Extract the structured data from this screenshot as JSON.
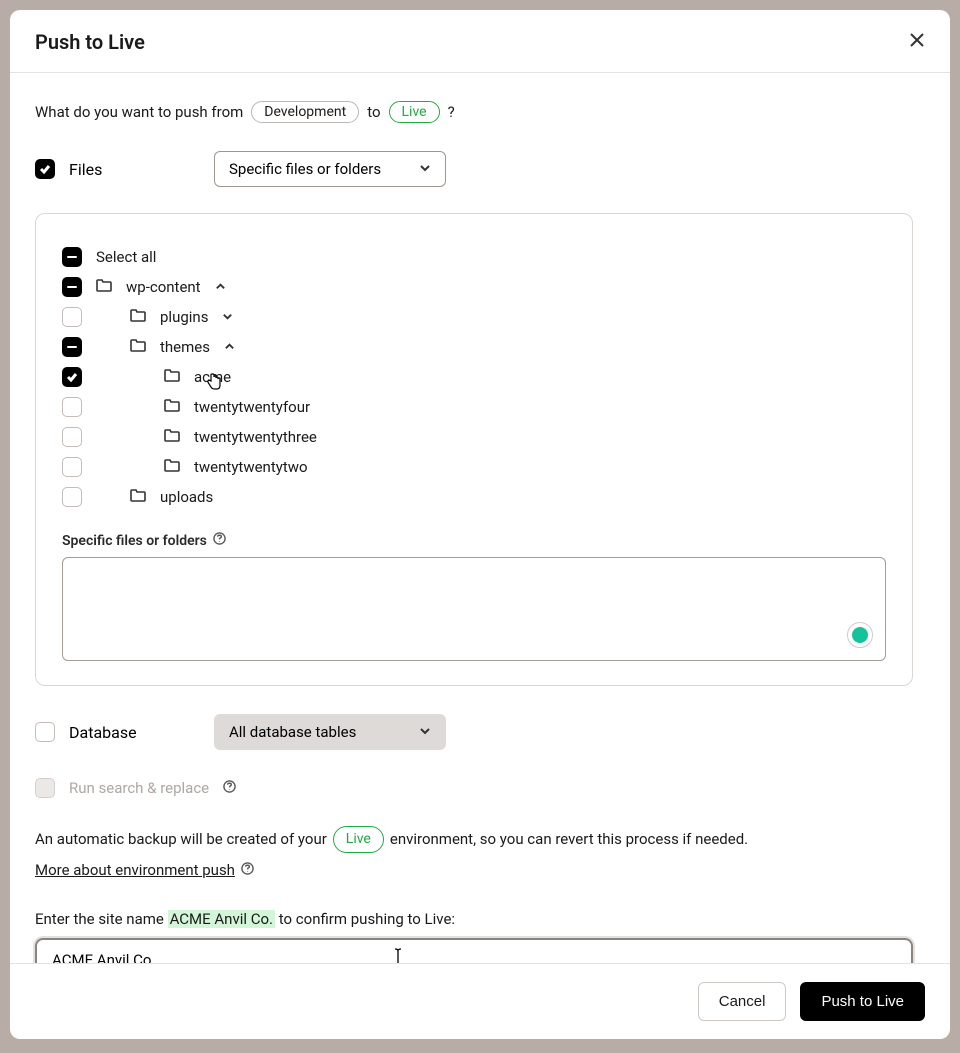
{
  "modal": {
    "title": "Push to Live",
    "question_prefix": "What do you want to push from",
    "from_env": "Development",
    "question_mid": "to",
    "to_env": "Live",
    "question_suffix": "?"
  },
  "files": {
    "label": "Files",
    "select_value": "Specific files or folders"
  },
  "tree": {
    "select_all": "Select all",
    "nodes": {
      "wp_content": "wp-content",
      "plugins": "plugins",
      "themes": "themes",
      "acme": "acme",
      "tt4": "twentytwentyfour",
      "tt3": "twentytwentythree",
      "tt2": "twentytwentytwo",
      "uploads": "uploads"
    },
    "spec_label": "Specific files or folders",
    "spec_value": ""
  },
  "database": {
    "label": "Database",
    "select_value": "All database tables"
  },
  "search_replace": {
    "label": "Run search & replace"
  },
  "backup": {
    "prefix": "An automatic backup will be created of your",
    "env": "Live",
    "suffix": "environment, so you can revert this process if needed.",
    "link": "More about environment push"
  },
  "confirm": {
    "label_prefix": "Enter the site name",
    "site_name": "ACME Anvil Co.",
    "label_suffix": "to confirm pushing to Live:",
    "value": "ACME Anvil Co."
  },
  "footer": {
    "cancel": "Cancel",
    "push": "Push to Live"
  }
}
